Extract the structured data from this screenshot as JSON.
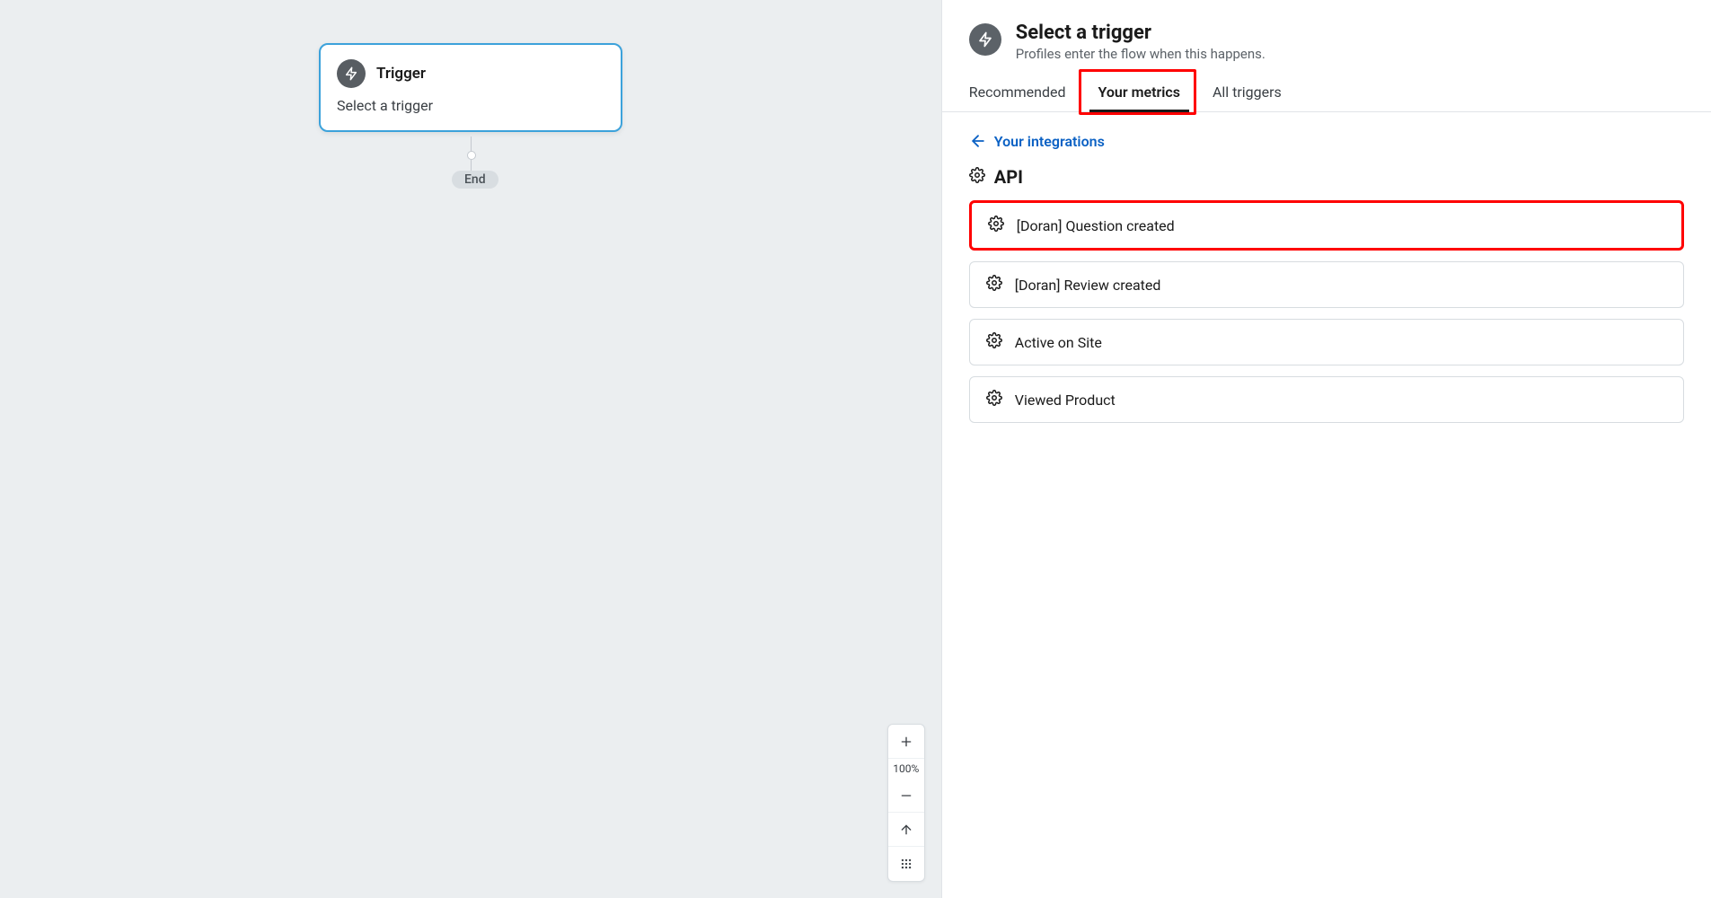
{
  "canvas": {
    "trigger_card": {
      "title": "Trigger",
      "subtext": "Select a trigger"
    },
    "end_label": "End"
  },
  "zoom": {
    "level": "100%"
  },
  "sidebar": {
    "header": {
      "title": "Select a trigger",
      "subtitle": "Profiles enter the flow when this happens."
    },
    "tabs": [
      {
        "label": "Recommended",
        "active": false
      },
      {
        "label": "Your metrics",
        "active": true,
        "highlighted": true
      },
      {
        "label": "All triggers",
        "active": false
      }
    ],
    "back_link": "Your integrations",
    "section": "API",
    "metrics": [
      {
        "label": "[Doran] Question created",
        "highlighted": true
      },
      {
        "label": "[Doran] Review created",
        "highlighted": false
      },
      {
        "label": "Active on Site",
        "highlighted": false
      },
      {
        "label": "Viewed Product",
        "highlighted": false
      }
    ]
  }
}
